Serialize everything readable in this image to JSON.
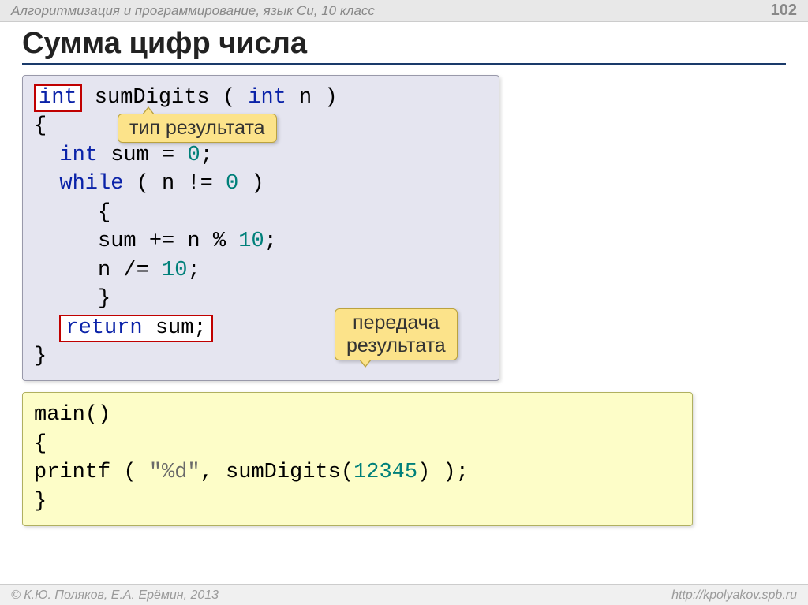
{
  "header": {
    "title": "Алгоритмизация и программирование, язык Си, 10 класс",
    "slide_number": "102"
  },
  "slide": {
    "title": "Сумма цифр числа"
  },
  "callouts": {
    "c1": "тип результата",
    "c2_line1": "передача",
    "c2_line2": "результата"
  },
  "code1": {
    "kw_int": "int",
    "fn_name": " sumDigits ( ",
    "kw_int2": "int",
    "fn_tail": " n )",
    "brace_open": "{",
    "decl_int": "int",
    "decl_rest": " sum = ",
    "zero": "0",
    "semi": ";",
    "kw_while": "while",
    "while_cond_a": " ( n != ",
    "while_cond_b": " )",
    "inner_open": "{",
    "stmt1_a": "sum += n % ",
    "stmt1_b": "10",
    "stmt2_a": "n /= ",
    "stmt2_b": "10",
    "inner_close": "}",
    "kw_return": "return",
    "ret_rest": " sum;",
    "brace_close": "}"
  },
  "code2": {
    "main": "main()",
    "brace_open": "{",
    "printf_a": " printf ( ",
    "printf_str": "\"%d\"",
    "printf_b": ", sumDigits(",
    "printf_num": "12345",
    "printf_c": ") );",
    "brace_close": "}"
  },
  "footer": {
    "copyright": "© К.Ю. Поляков, Е.А. Ерёмин, 2013",
    "url": "http://kpolyakov.spb.ru"
  }
}
